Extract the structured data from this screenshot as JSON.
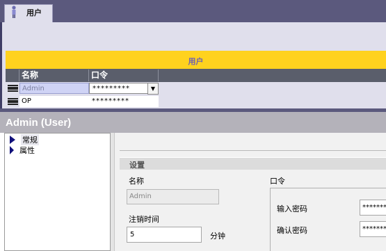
{
  "tab": {
    "label": "用户",
    "icon": "user-icon"
  },
  "editor": {
    "title": "用户",
    "columns": {
      "name": "名称",
      "password": "口令"
    },
    "rows": [
      {
        "name": "Admin",
        "password": "*********"
      },
      {
        "name": "OP",
        "password": "*********"
      }
    ]
  },
  "inspector": {
    "title": "Admin (User)",
    "nav": [
      {
        "label": "常规",
        "icon": "arrow-right-icon"
      },
      {
        "label": "属性",
        "icon": "arrow-right-icon"
      }
    ],
    "settings": {
      "header": "设置",
      "name_label": "名称",
      "name_value": "Admin",
      "logout_label": "注销时间",
      "logout_value": "5",
      "logout_unit": "分钟",
      "password_group": "口令",
      "enter_password_label": "输入密码",
      "enter_password_value": "*********",
      "confirm_password_label": "确认密码",
      "confirm_password_value": "*********"
    }
  },
  "colors": {
    "title_strip": "#ffd21e",
    "table_header": "#5a5e6b",
    "frame": "#5b597d",
    "accent": "#6f62b0"
  }
}
